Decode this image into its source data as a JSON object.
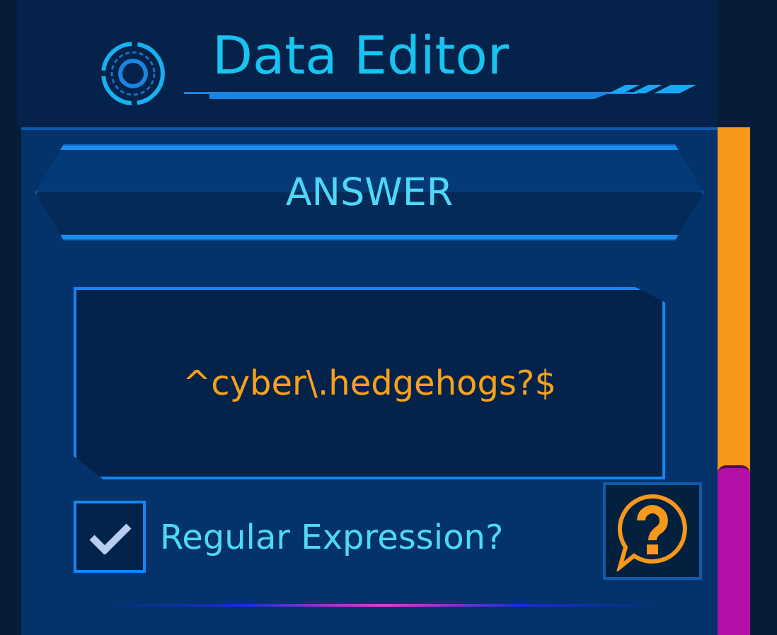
{
  "title": "Data Editor",
  "section": "ANSWER",
  "answer": {
    "value": "^cyber\\.hedgehogs?$"
  },
  "regex": {
    "label": "Regular Expression?",
    "checked": true
  }
}
